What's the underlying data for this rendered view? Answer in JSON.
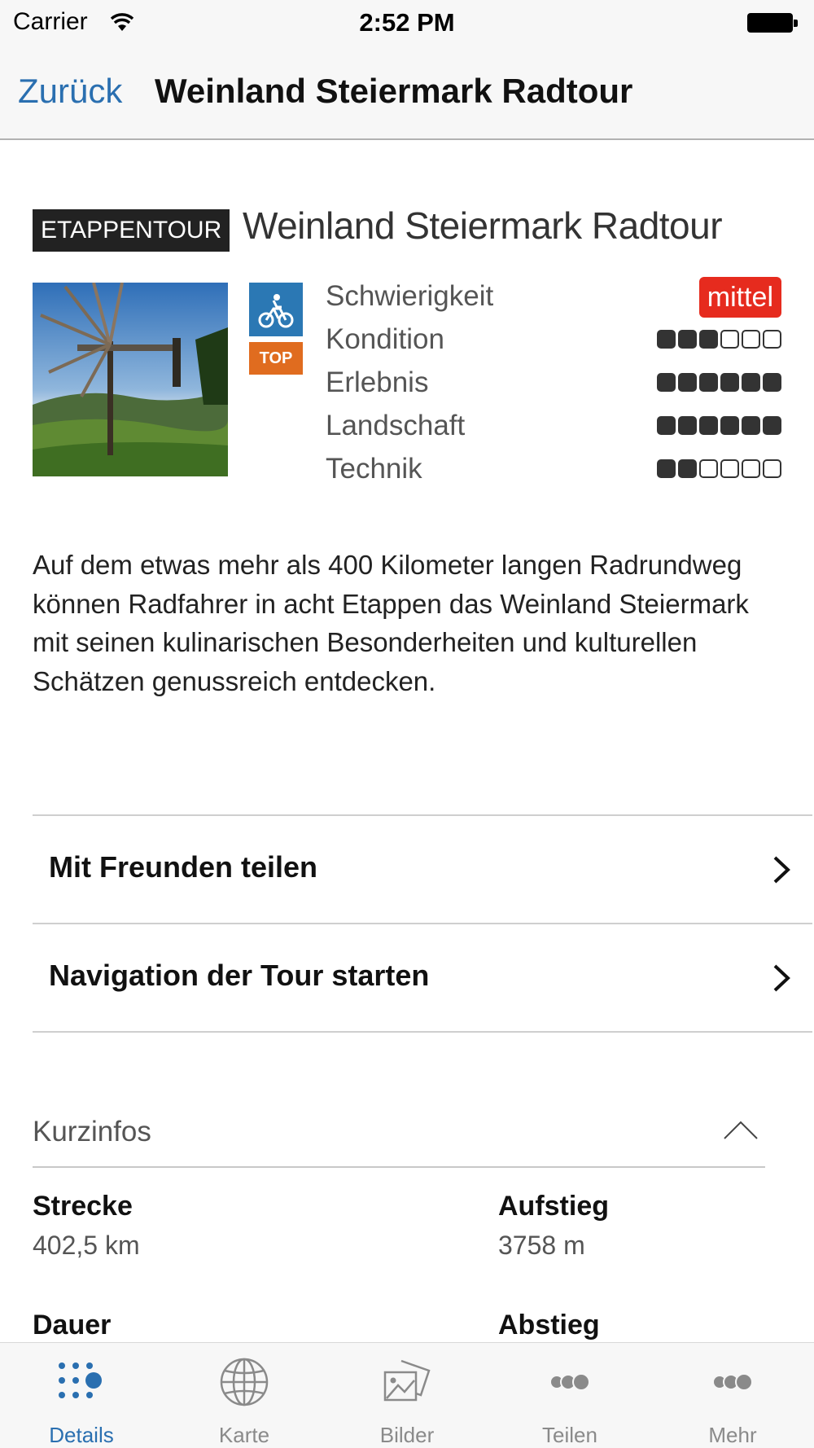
{
  "status_bar": {
    "carrier": "Carrier",
    "time": "2:52 PM"
  },
  "nav": {
    "back_label": "Zurück",
    "title": "Weinland Steiermark Radtour"
  },
  "tour": {
    "type_badge": "ETAPPENTOUR",
    "title": "Weinland Steiermark Radtour",
    "top_badge": "TOP",
    "difficulty": {
      "label": "Schwierigkeit",
      "value": "mittel",
      "color": "#e62b1e"
    },
    "ratings": [
      {
        "label": "Kondition",
        "filled": 3,
        "max": 6
      },
      {
        "label": "Erlebnis",
        "filled": 6,
        "max": 6
      },
      {
        "label": "Landschaft",
        "filled": 6,
        "max": 6
      },
      {
        "label": "Technik",
        "filled": 2,
        "max": 6
      }
    ],
    "description": "Auf dem etwas mehr als 400 Kilometer langen Radrundweg können Radfahrer in acht Etappen das Weinland Steiermark mit seinen kulinarischen Besonderheiten und kulturellen Schätzen genussreich entdecken."
  },
  "actions": [
    {
      "label": "Mit Freunden teilen"
    },
    {
      "label": "Navigation der Tour starten"
    }
  ],
  "kurzinfos": {
    "title": "Kurzinfos",
    "items": [
      {
        "label": "Strecke",
        "value": "402,5 km"
      },
      {
        "label": "Aufstieg",
        "value": "3758 m"
      },
      {
        "label": "Dauer",
        "value": ""
      },
      {
        "label": "Abstieg",
        "value": ""
      }
    ]
  },
  "tabs": [
    {
      "label": "Details",
      "icon": "dots-grid-icon",
      "active": true
    },
    {
      "label": "Karte",
      "icon": "globe-icon",
      "active": false
    },
    {
      "label": "Bilder",
      "icon": "pictures-icon",
      "active": false
    },
    {
      "label": "Teilen",
      "icon": "share-icon",
      "active": false
    },
    {
      "label": "Mehr",
      "icon": "more-icon",
      "active": false
    }
  ],
  "colors": {
    "accent": "#2a6fb0",
    "bike_badge": "#2b78b4",
    "top_badge": "#e06c1f"
  }
}
